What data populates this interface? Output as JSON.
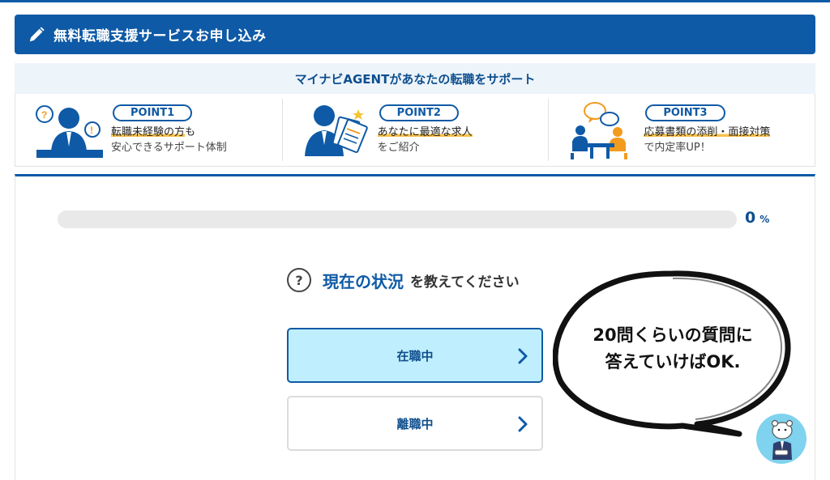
{
  "header": {
    "title": "無料転職支援サービスお申し込み",
    "icon": "pencil-icon"
  },
  "banner": {
    "text": "マイナビAGENTがあなたの転職をサポート"
  },
  "points": [
    {
      "label": "POINT1",
      "highlight": "転職未経験の方",
      "highlight_suffix": "も",
      "line2": "安心できるサポート体制",
      "icon": "consultant-icon"
    },
    {
      "label": "POINT2",
      "highlight": "あなたに最適な求人",
      "highlight_suffix": "",
      "line2": "をご紹介",
      "icon": "job-documents-icon"
    },
    {
      "label": "POINT3",
      "highlight": "応募書類の添削・面接対策",
      "highlight_suffix": "",
      "line2": "で内定率UP！",
      "icon": "interview-icon"
    }
  ],
  "progress": {
    "value": "0",
    "unit": "%",
    "fraction": 0
  },
  "question": {
    "strong": "現在の状況",
    "rest": "を教えてください",
    "icon": "question-icon"
  },
  "choices": [
    {
      "label": "在職中",
      "selected": true
    },
    {
      "label": "離職中",
      "selected": false
    }
  ],
  "bubble": {
    "line1": "20問くらいの質問に",
    "line2": "答えていけばOK."
  },
  "colors": {
    "primary": "#0f5aa6",
    "banner_bg": "#edf4fa",
    "selected_bg": "#bfeeff",
    "highlight": "#f7c24a"
  }
}
